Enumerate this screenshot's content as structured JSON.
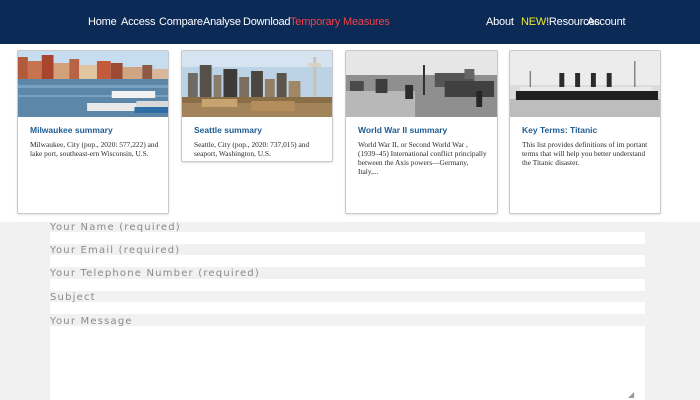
{
  "nav": {
    "left_items": [
      "Home",
      "Access",
      "Compare",
      "Analyse",
      "Download"
    ],
    "temporary": "Temporary Measures",
    "about": "About",
    "new_badge": "NEW!",
    "resources": "Resources",
    "account": "Account"
  },
  "cards": [
    {
      "title": "Milwaukee summary",
      "text": "Milwaukee, City (pop., 2020: 577,222) and lake port, southeast-ern Wisconsin, U.S.",
      "image": "milwaukee-harbor-photo"
    },
    {
      "title": "Seattle summary",
      "text": "Seattle, City (pop., 2020: 737,015) and seaport, Washington, U.S.",
      "image": "seattle-skyline-photo"
    },
    {
      "title": "World War II summary",
      "text": "World War II, or Second World War , (1939–45) International conflict principally between the Axis powers—Germany, Italy,...",
      "image": "ww2-battlefield-photo"
    },
    {
      "title": "Key Terms: Titanic",
      "text": "This list provides definitions of im portant terms that will help you better understand the Titanic disaster.",
      "image": "titanic-ship-photo"
    }
  ],
  "form": {
    "name_label": "Your Name (required)",
    "email_label": "Your Email (required)",
    "phone_label": "Your Telephone Number (required)",
    "subject_label": "Subject",
    "message_label": "Your Message"
  },
  "colors": {
    "nav_bg": "#0b2a55",
    "temporary_measures": "#f0424a",
    "new_badge": "#f3e82a",
    "card_title": "#1d5c93",
    "form_bg": "#f1f1f1"
  }
}
